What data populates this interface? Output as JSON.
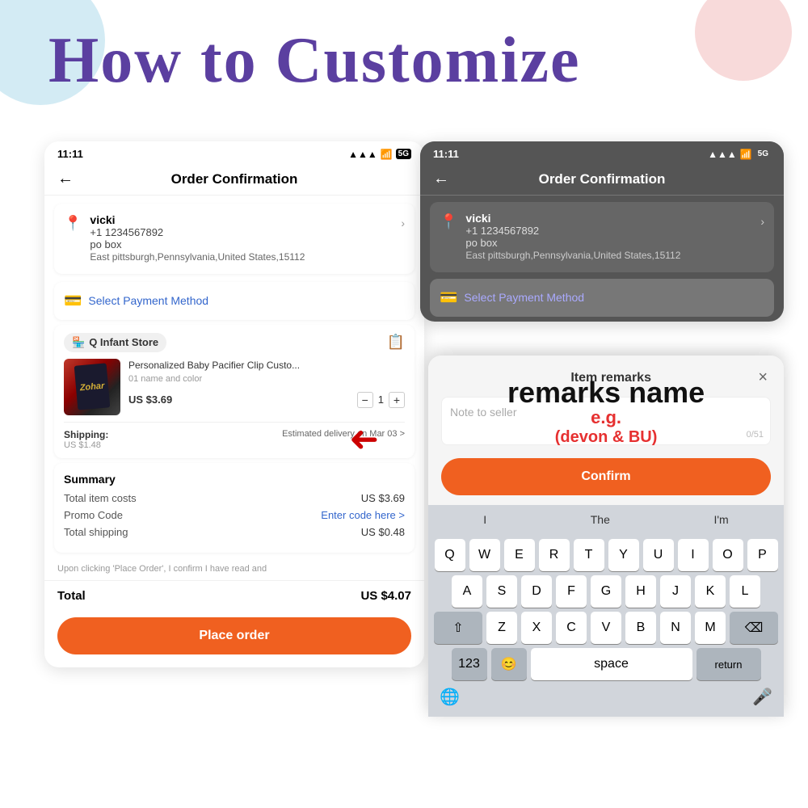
{
  "page": {
    "title": "How to Customize",
    "bg_circle_colors": [
      "#a8d8ea",
      "#f4c2c2"
    ]
  },
  "left_phone": {
    "status_bar": {
      "time": "11:11",
      "signal": "signal-icon",
      "wifi": "wifi-icon",
      "network": "5G"
    },
    "nav": {
      "back_label": "←",
      "title": "Order Confirmation"
    },
    "address": {
      "name": "vicki",
      "phone": "+1 1234567892",
      "box": "po box",
      "location": "East pittsburgh,Pennsylvania,United States,15112"
    },
    "payment": {
      "label": "Select Payment Method"
    },
    "store": {
      "name": "Q Infant Store",
      "product_name": "Personalized Baby Pacifier Clip Custo...",
      "product_variant": "01 name and color",
      "price": "US $3.69",
      "quantity": "1",
      "shipping_label": "Shipping:",
      "shipping_cost": "US $1.48",
      "delivery": "Estimated delivery on Mar 03 >"
    },
    "summary": {
      "title": "Summary",
      "item_costs_label": "Total item costs",
      "item_costs_value": "US $3.69",
      "promo_label": "Promo Code",
      "promo_value": "Enter code here >",
      "shipping_label": "Total shipping",
      "shipping_value": "US $0.48"
    },
    "footer_note": "Upon clicking 'Place Order', I confirm I have read and",
    "total_label": "Total",
    "total_value": "US $4.07",
    "place_order_label": "Place order"
  },
  "right_phone": {
    "status_bar": {
      "time": "11:11"
    },
    "nav": {
      "back_label": "←",
      "title": "Order Confirmation"
    },
    "address": {
      "name": "vicki",
      "phone": "+1 1234567892",
      "box": "po box",
      "location": "East pittsburgh,Pennsylvania,United States,15112"
    },
    "payment": {
      "label": "Select Payment Method"
    }
  },
  "remarks_modal": {
    "title": "Item remarks",
    "close_label": "×",
    "placeholder": "Note to seller",
    "char_count": "0/51",
    "confirm_label": "Confirm",
    "annotation_line1": "remarks name",
    "annotation_line2": "e.g.",
    "annotation_line3": "(devon & BU)"
  },
  "keyboard": {
    "suggestions": [
      "I",
      "The",
      "I'm"
    ],
    "row1": [
      "Q",
      "W",
      "E",
      "R",
      "T",
      "Y",
      "U",
      "I",
      "O",
      "P"
    ],
    "row2": [
      "A",
      "S",
      "D",
      "F",
      "G",
      "H",
      "J",
      "K",
      "L"
    ],
    "row3": [
      "Z",
      "X",
      "C",
      "V",
      "B",
      "N",
      "M"
    ],
    "bottom": {
      "num": "123",
      "emoji": "😊",
      "space": "space",
      "return": "return"
    }
  }
}
